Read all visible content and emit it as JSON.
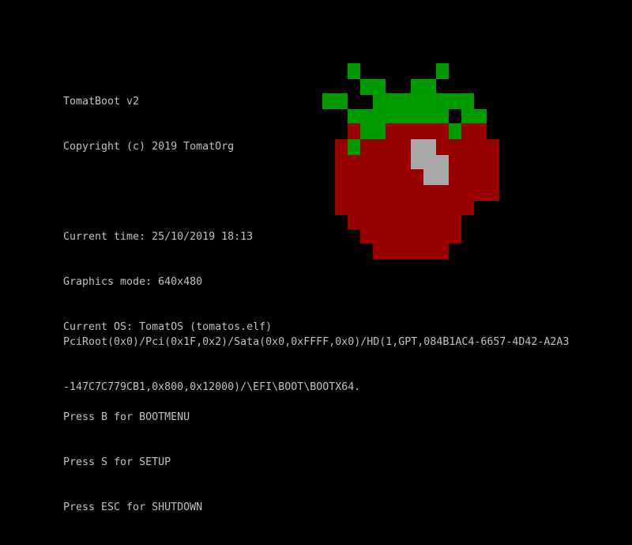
{
  "boot": {
    "title": "TomatBoot v2",
    "copyright": "Copyright (c) 2019 TomatOrg",
    "current_time": "Current time: 25/10/2019 18:13",
    "graphics_mode": "Graphics mode: 640x480",
    "current_os": "Current OS: TomatOS (tomatos.elf)",
    "press_boot": "Press B for BOOTMENU",
    "press_setup": "Press S for SETUP",
    "press_shutdown": "Press ESC for SHUTDOWN",
    "device_path_line1": "PciRoot(0x0)/Pci(0x1F,0x2)/Sata(0x0,0xFFFF,0x0)/HD(1,GPT,084B1AC4-6657-4D42-A2A3",
    "device_path_line2": "-147C7C779CB1,0x800,0x12000)/\\EFI\\BOOT\\BOOTX64."
  },
  "colors": {
    "background": "#000000",
    "text": "#c0c0c0",
    "tomato_red": "#990000",
    "leaf_green": "#009900",
    "highlight_gray": "#a8a8a8"
  },
  "logo": {
    "icon": "tomato-logo-icon"
  }
}
